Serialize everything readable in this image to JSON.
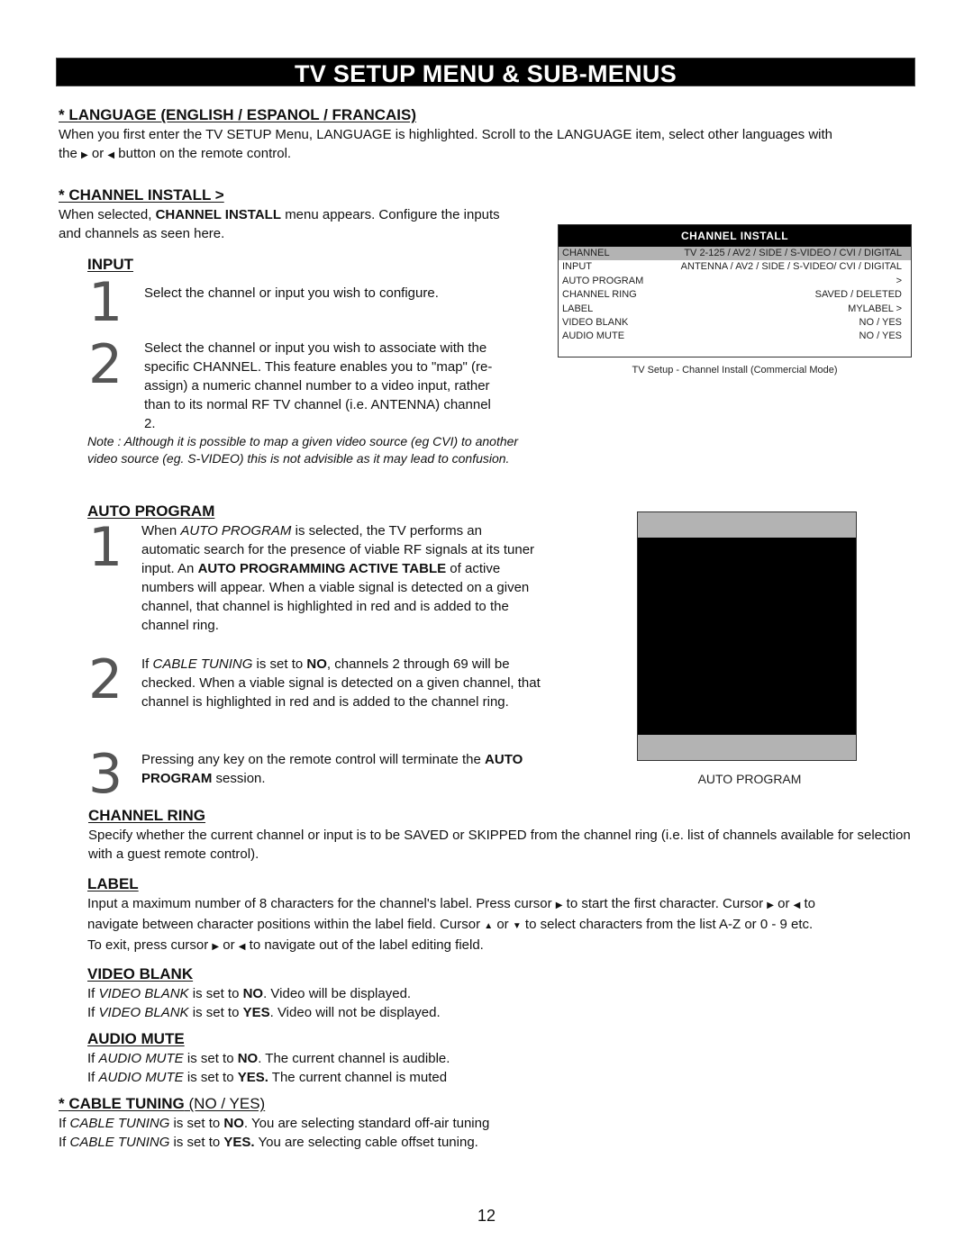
{
  "page": {
    "title": "TV SETUP MENU & SUB-MENUS",
    "page_number": "12"
  },
  "language": {
    "heading": "* LANGUAGE (ENGLISH / ESPANOL / FRANCAIS)",
    "text_line1": "When you first enter the TV SETUP Menu, LANGUAGE is highlighted. Scroll to the LANGUAGE item, select other languages with",
    "text_line2_a": "the",
    "text_line2_b": "or",
    "text_line2_c": "button on the remote control."
  },
  "channel_install": {
    "heading": "* CHANNEL INSTALL >",
    "text_a": "When selected,",
    "text_bold": "CHANNEL INSTALL",
    "text_b": "menu appears. Configure the inputs and channels as seen here."
  },
  "input": {
    "heading": "INPUT",
    "steps": [
      {
        "num": "1",
        "text": "Select the channel or input you wish to configure."
      },
      {
        "num": "2",
        "text": "Select the channel or input you wish to associate with the specific CHANNEL.  This feature enables you to \"map\" (re-assign) a numeric channel number to a video input, rather than to its normal RF TV channel (i.e. ANTENNA) channel 2."
      }
    ],
    "note": "Note : Although it is possible to map a given video source (eg CVI) to another video source (eg. S-VIDEO) this is not advisible as it may lead to confusion."
  },
  "menu_figure": {
    "header": "CHANNEL  INSTALL",
    "rows": [
      {
        "label": "CHANNEL",
        "value": "TV 2-125 / AV2 / SIDE / S-VIDEO / CVI / DIGITAL",
        "selected": true
      },
      {
        "label": "INPUT",
        "value": "ANTENNA / AV2  / SIDE / S-VIDEO/ CVI / DIGITAL",
        "selected": false
      },
      {
        "label": "AUTO PROGRAM",
        "value": ">",
        "selected": false
      },
      {
        "label": "CHANNEL RING",
        "value": "SAVED / DELETED",
        "selected": false
      },
      {
        "label": "LABEL",
        "value": "MYLABEL >",
        "selected": false
      },
      {
        "label": "VIDEO BLANK",
        "value": "NO / YES",
        "selected": false
      },
      {
        "label": "AUDIO MUTE",
        "value": "NO / YES",
        "selected": false
      }
    ],
    "caption": "TV Setup - Channel Install (Commercial Mode)",
    "highlight_color": "#b3b3b3"
  },
  "auto_program": {
    "heading": "AUTO PROGRAM",
    "step1": {
      "num": "1",
      "a": "When",
      "italic": "AUTO PROGRAM",
      "b": "is selected, the TV performs an automatic search for the presence of viable RF signals at its tuner input.  An",
      "bold": "AUTO PROGRAMMING ACTIVE TABLE",
      "c": "of active numbers will appear.  When a viable signal is detected on a given channel, that channel is highlighted in red and is added to the channel ring."
    },
    "step2": {
      "num": "2",
      "a": "If",
      "italic": "CABLE TUNING",
      "b": "is set to",
      "bold": "NO",
      "c": ", channels 2 through 69 will be checked.  When a viable signal is detected on a given channel, that channel is highlighted in red and is added to the channel ring."
    },
    "step3": {
      "num": "3",
      "a": "Pressing any key on the remote control will terminate the",
      "bold": "AUTO PROGRAM",
      "b": "session."
    },
    "figure_caption": "AUTO PROGRAM"
  },
  "channel_ring": {
    "heading": "CHANNEL RING",
    "text": "Specify whether the current channel or input is to be SAVED or SKIPPED from the channel ring (i.e. list of channels available for selection with a guest remote control)."
  },
  "label": {
    "heading": "LABEL",
    "line1_a": "Input a maximum number of 8 characters for the channel's label.  Press cursor",
    "line1_b": "to start the first character.  Cursor",
    "line1_c": "or",
    "line1_d": "to",
    "line2_a": "navigate between character positions within the label field.  Cursor",
    "line2_b": "or",
    "line2_c": "to select characters from the list A-Z or 0 - 9 etc.",
    "line3_a": "To exit, press cursor",
    "line3_b": "or",
    "line3_c": "to navigate out of the label editing field."
  },
  "video_blank": {
    "heading": "VIDEO BLANK",
    "lines": [
      {
        "a": "If",
        "italic": "VIDEO BLANK",
        "b": "is set to",
        "bold": "NO",
        "c": ".  Video will be displayed."
      },
      {
        "a": "If",
        "italic": "VIDEO BLANK",
        "b": "is set to",
        "bold": "YES",
        "c": ".  Video will not be displayed."
      }
    ]
  },
  "audio_mute": {
    "heading": "AUDIO MUTE",
    "lines": [
      {
        "a": "If",
        "italic": "AUDIO MUTE",
        "b": "is set to",
        "bold": "NO",
        "c": ". The current channel is audible."
      },
      {
        "a": "If",
        "italic": "AUDIO MUTE",
        "b": "is set to",
        "bold": "YES.",
        "c": " The current channel is muted"
      }
    ]
  },
  "cable_tuning": {
    "heading": "* CABLE TUNING",
    "heading_suffix": "(NO / YES)",
    "lines": [
      {
        "a": "If",
        "italic": "CABLE TUNING",
        "b": "is set to",
        "bold": "NO",
        "c": ".  You are selecting standard off-air tuning"
      },
      {
        "a": "If",
        "italic": "CABLE TUNING",
        "b": "is set to",
        "bold": "YES.",
        "c": "   You are selecting cable offset tuning."
      }
    ]
  },
  "icons": {
    "right": "▶",
    "left": "◀",
    "up": "▲",
    "down": "▼"
  }
}
